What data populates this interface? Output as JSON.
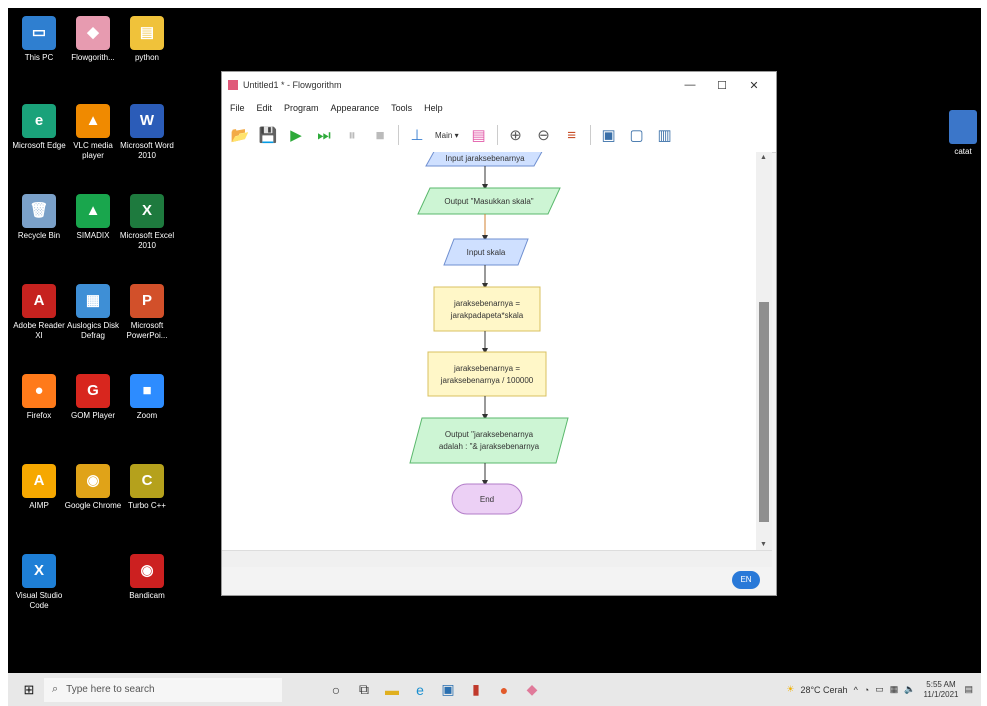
{
  "desktop_icons": [
    {
      "label": "This PC",
      "color": "#2f7fd0",
      "glyph": "▭"
    },
    {
      "label": "Flowgorith...",
      "color": "#e79bb0",
      "glyph": "◆"
    },
    {
      "label": "python",
      "color": "#f0c23a",
      "glyph": "▤"
    },
    {
      "label": "Microsoft Edge",
      "color": "#1aa27a",
      "glyph": "e"
    },
    {
      "label": "VLC media player",
      "color": "#f08a00",
      "glyph": "▲"
    },
    {
      "label": "Microsoft Word 2010",
      "color": "#2b5cb8",
      "glyph": "W"
    },
    {
      "label": "Recycle Bin",
      "color": "#7aa0c8",
      "glyph": "🗑"
    },
    {
      "label": "SIMADIX",
      "color": "#19a64d",
      "glyph": "▲"
    },
    {
      "label": "Microsoft Excel 2010",
      "color": "#1e7a3e",
      "glyph": "X"
    },
    {
      "label": "Adobe Reader XI",
      "color": "#c6221f",
      "glyph": "A"
    },
    {
      "label": "Auslogics Disk Defrag",
      "color": "#3e8fd6",
      "glyph": "▦"
    },
    {
      "label": "Microsoft PowerPoi...",
      "color": "#d2502a",
      "glyph": "P"
    },
    {
      "label": "Firefox",
      "color": "#ff7a1a",
      "glyph": "●"
    },
    {
      "label": "GOM Player",
      "color": "#d8261e",
      "glyph": "G"
    },
    {
      "label": "Zoom",
      "color": "#2d8cff",
      "glyph": "■"
    },
    {
      "label": "AIMP",
      "color": "#f6a800",
      "glyph": "A"
    },
    {
      "label": "Google Chrome",
      "color": "#e0a318",
      "glyph": "◉"
    },
    {
      "label": "Turbo C++",
      "color": "#b5a11c",
      "glyph": "C"
    },
    {
      "label": "Visual Studio Code",
      "color": "#1e7fd6",
      "glyph": "X"
    },
    {
      "label": "",
      "color": "",
      "glyph": ""
    },
    {
      "label": "Bandicam",
      "color": "#cc2020",
      "glyph": "◉"
    }
  ],
  "right_icon": {
    "label": "catat"
  },
  "window": {
    "title": "Untitled1 * - Flowgorithm",
    "menu": [
      "File",
      "Edit",
      "Program",
      "Appearance",
      "Tools",
      "Help"
    ],
    "toolbar_dropdown": "Main",
    "lang_button": "EN"
  },
  "flowchart": {
    "top_partial": "Input jaraksebenarnya",
    "nodes": [
      {
        "type": "output",
        "text": "Output \"Masukkan skala\""
      },
      {
        "type": "input",
        "text": "Input skala"
      },
      {
        "type": "assign",
        "lines": [
          "jaraksebenarnya =",
          "jarakpadapeta*skala"
        ]
      },
      {
        "type": "assign",
        "lines": [
          "jaraksebenarnya =",
          "jaraksebenarnya / 100000"
        ]
      },
      {
        "type": "output",
        "lines": [
          "Output \"jaraksebenarnya",
          "adalah : \"& jaraksebenarnya"
        ]
      },
      {
        "type": "end",
        "text": "End"
      }
    ]
  },
  "taskbar": {
    "search_placeholder": "Type here to search",
    "weather": "28°C Cerah",
    "time": "5:55 AM",
    "date": "11/1/2021"
  }
}
